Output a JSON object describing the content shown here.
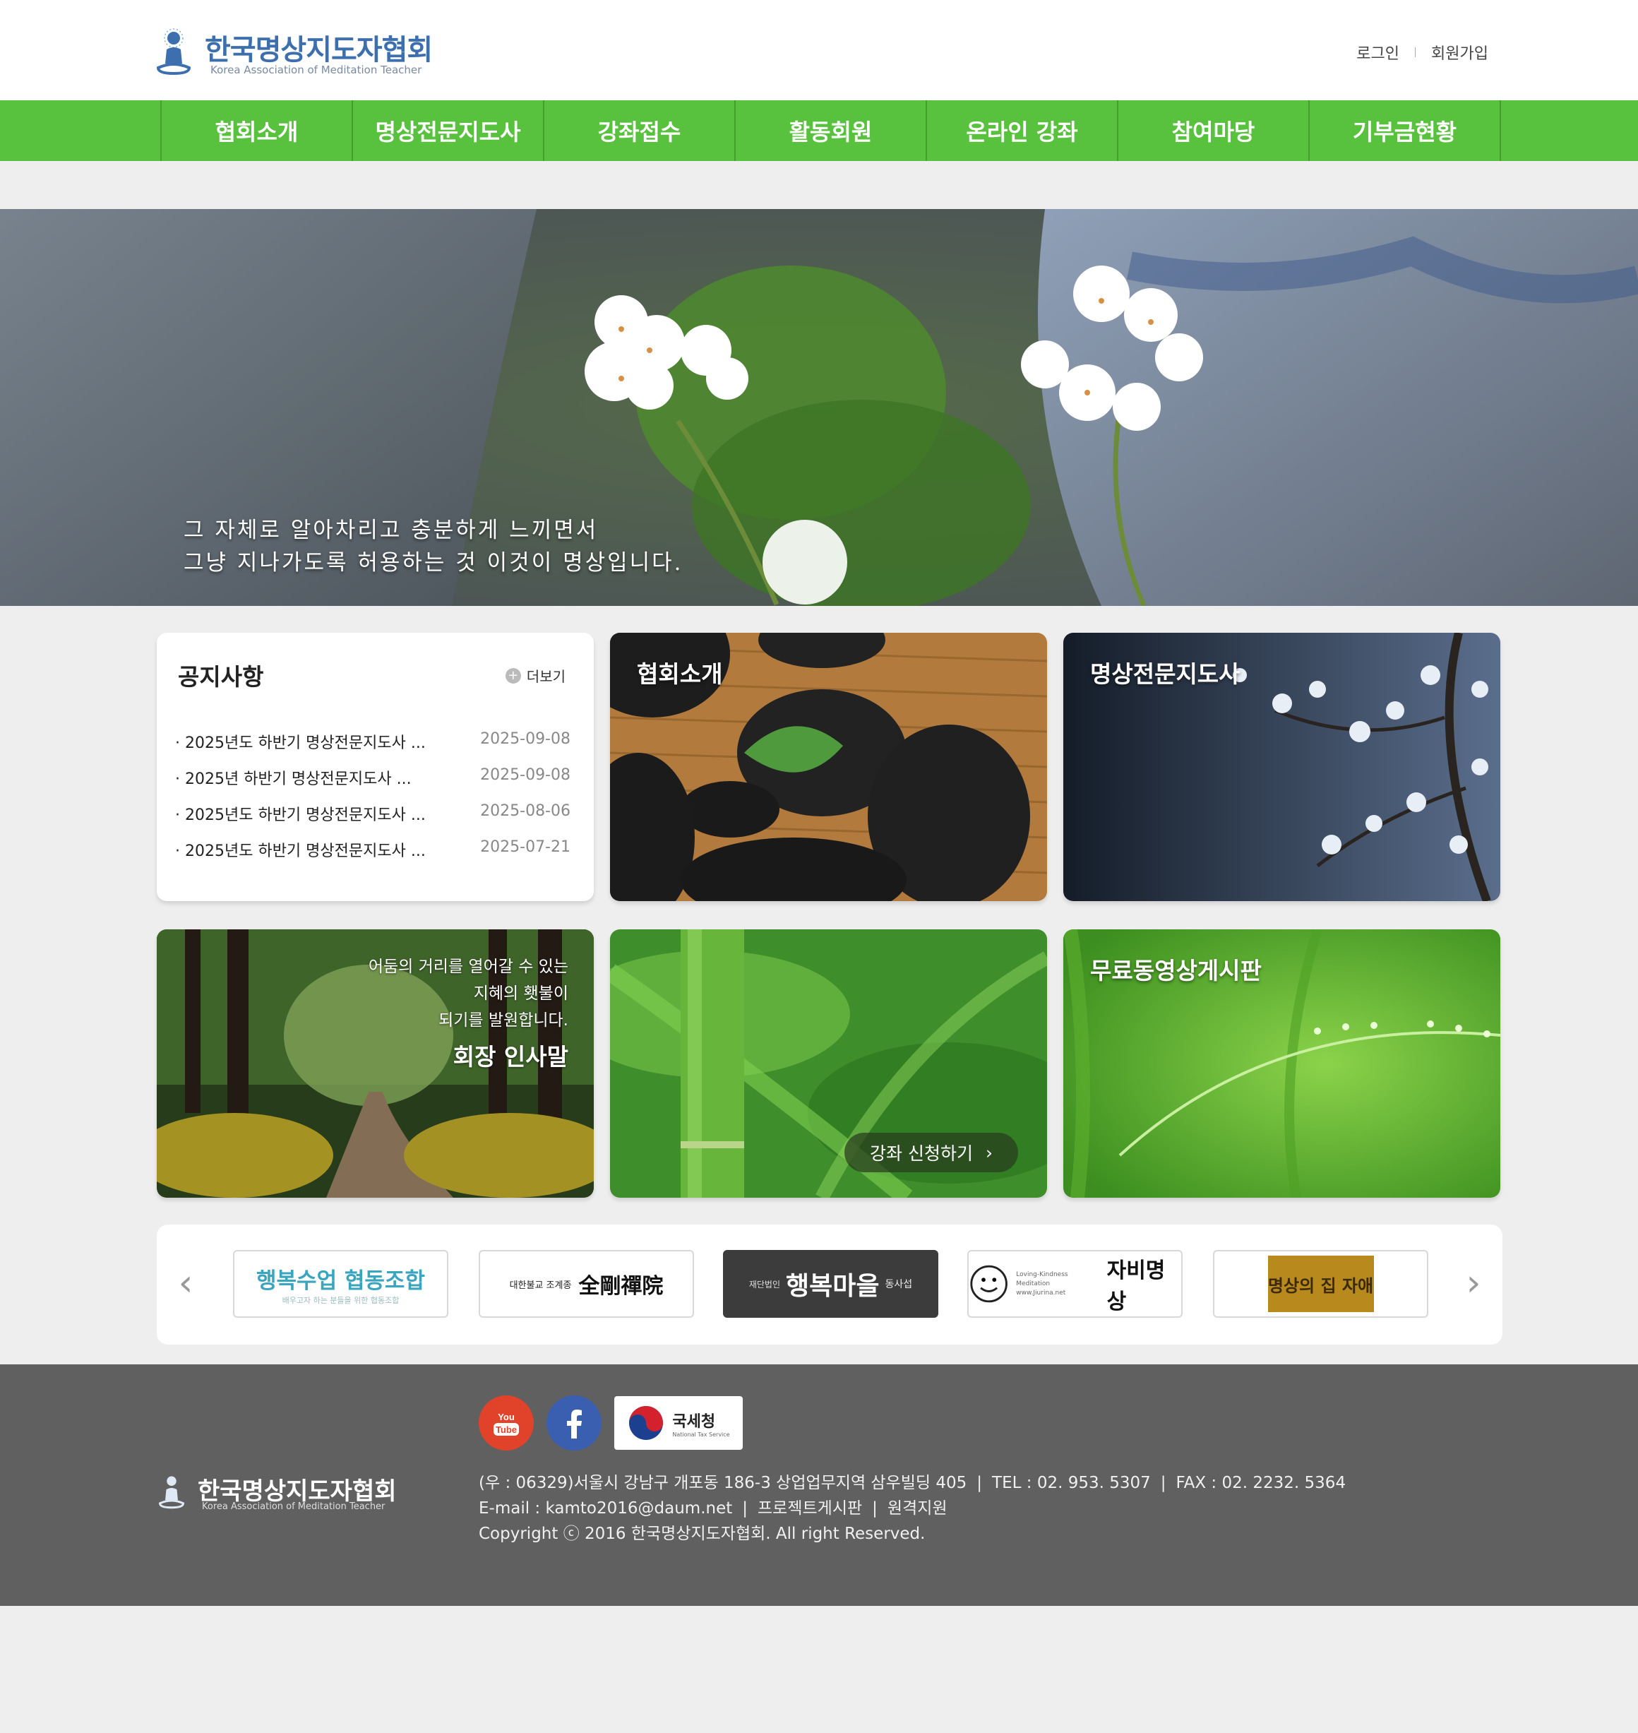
{
  "header": {
    "logo_title": "한국명상지도자협회",
    "logo_subtitle": "Korea Association of Meditation Teacher",
    "login": "로그인",
    "signup": "회원가입"
  },
  "nav": {
    "items": [
      "협회소개",
      "명상전문지도사",
      "강좌접수",
      "활동회원",
      "온라인 강좌",
      "참여마당",
      "기부금현황"
    ]
  },
  "hero": {
    "line1": "그 자체로 알아차리고 충분하게 느끼면서",
    "line2": "그냥 지나가도록 허용하는 것 이것이 명상입니다."
  },
  "notice": {
    "title": "공지사항",
    "more": "더보기",
    "items": [
      {
        "title": "· 2025년도 하반기 명상전문지도사 ...",
        "date": "2025-09-08"
      },
      {
        "title": "· 2025년 하반기 명상전문지도사 ...",
        "date": "2025-09-08"
      },
      {
        "title": "· 2025년도 하반기 명상전문지도사 ...",
        "date": "2025-08-06"
      },
      {
        "title": "· 2025년도 하반기 명상전문지도사 ...",
        "date": "2025-07-21"
      }
    ]
  },
  "cards": {
    "about": "협회소개",
    "instructor": "명상전문지도사",
    "greeting_line1": "어둠의 거리를 열어갈 수 있는",
    "greeting_line2": "지혜의 횃불이",
    "greeting_line3": "되기를 발원합니다.",
    "greeting_title": "회장 인사말",
    "apply": "강좌 신청하기",
    "video": "무료동영상게시판"
  },
  "partners": {
    "items": [
      {
        "name": "행복수업 협동조합",
        "sub": "배우고자 하는 분들을 위한 협동조합"
      },
      {
        "name": "全剛禪院",
        "sub": "대한불교 조계종"
      },
      {
        "name": "행복마을",
        "sub": "재단법인",
        "tag": "동사섭"
      },
      {
        "name": "자비명상",
        "sub": "Loving-Kindness Meditation",
        "url": "www.Jiurina.net"
      },
      {
        "name": "명상의 집 자애",
        "sub": ""
      }
    ]
  },
  "footer": {
    "logo_title": "한국명상지도자협회",
    "logo_subtitle": "Korea Association of Meditation Teacher",
    "nts_label": "국세청",
    "nts_sub": "National Tax Service",
    "address": "(우 : 06329)서울시 강남구 개포동 186-3 상업업무지역 삼우빌딩 405",
    "tel": "TEL : 02. 953. 5307",
    "fax": "FAX : 02. 2232. 5364",
    "email": "E-mail : kamto2016@daum.net",
    "project_board": "프로젝트게시판",
    "remote": "원격지원",
    "copyright": "Copyright ⓒ 2016 한국명상지도자협회. All right Reserved."
  },
  "colors": {
    "nav_green": "#58c13d",
    "footer_gray": "#606060",
    "logo_blue": "#3d6fae"
  }
}
